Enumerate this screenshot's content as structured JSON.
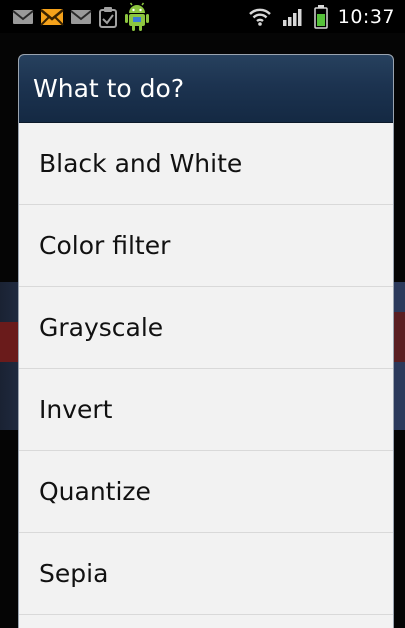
{
  "status_bar": {
    "time": "10:37",
    "notification_icons": [
      "gmail-icon",
      "email-icon",
      "gmail-icon",
      "clipboard-check-icon",
      "android-icon"
    ],
    "system_icons": [
      "wifi-icon",
      "signal-icon",
      "battery-icon"
    ],
    "colors": {
      "email_envelope": "#f5a21b",
      "battery": "#56c23a",
      "android": "#8dc63f"
    }
  },
  "dialog": {
    "title": "What to do?",
    "options": [
      {
        "label": "Black and White"
      },
      {
        "label": "Color filter"
      },
      {
        "label": "Grayscale"
      },
      {
        "label": "Invert"
      },
      {
        "label": "Quantize"
      },
      {
        "label": "Sepia"
      }
    ],
    "colors": {
      "header_bg": "#1c3350",
      "list_bg": "#f2f2f2"
    }
  }
}
